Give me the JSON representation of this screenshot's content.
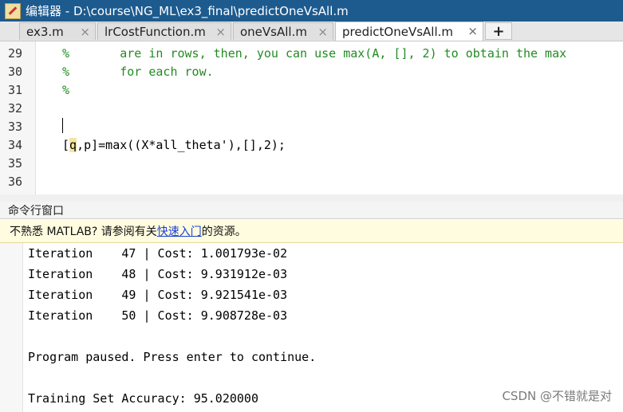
{
  "window": {
    "title": "编辑器 - D:\\course\\NG_ML\\ex3_final\\predictOneVsAll.m"
  },
  "tabs": [
    {
      "label": "ex3.m",
      "close": "×"
    },
    {
      "label": "lrCostFunction.m",
      "close": "×"
    },
    {
      "label": "oneVsAll.m",
      "close": "×"
    },
    {
      "label": "predictOneVsAll.m",
      "close": "×"
    }
  ],
  "add_tab_label": "+",
  "editor": {
    "lines": [
      {
        "num": "29",
        "text": "%       are in rows, then, you can use max(A, [], 2) to obtain the max"
      },
      {
        "num": "30",
        "text": "%       for each row."
      },
      {
        "num": "31",
        "text": "%"
      },
      {
        "num": "32",
        "text": ""
      },
      {
        "num": "33",
        "text": ""
      },
      {
        "num": "34",
        "text_pre": "[",
        "text_hl": "q",
        "text_post": ",p]=max((X*all_theta'),[],2);"
      },
      {
        "num": "35",
        "text": ""
      },
      {
        "num": "36",
        "text": ""
      }
    ]
  },
  "command_window": {
    "title": "命令行窗口",
    "notice_pre": "不熟悉 MATLAB? 请参阅有关",
    "notice_link": "快速入门",
    "notice_post": "的资源。",
    "output": [
      "Iteration    47 | Cost: 1.001793e-02",
      "Iteration    48 | Cost: 9.931912e-03",
      "Iteration    49 | Cost: 9.921541e-03",
      "Iteration    50 | Cost: 9.908728e-03",
      "",
      "Program paused. Press enter to continue.",
      "",
      "Training Set Accuracy: 95.020000"
    ]
  },
  "watermark": "CSDN @不错就是对"
}
